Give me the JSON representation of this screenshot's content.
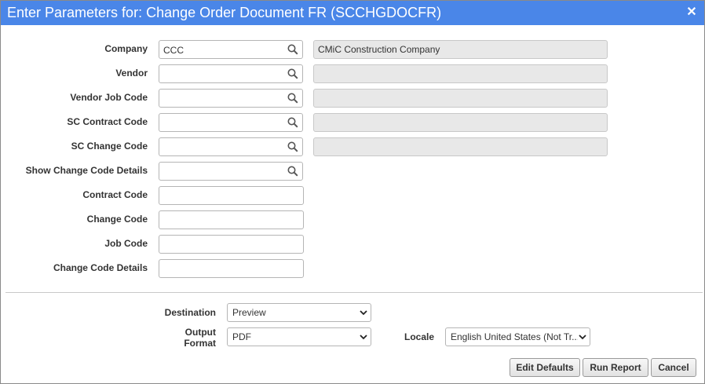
{
  "window": {
    "title": "Enter Parameters for: Change Order Document FR (SCCHGDOCFR)",
    "close_icon": "close-icon"
  },
  "parameters": [
    {
      "label": "Company",
      "value": "CCC",
      "lov": true,
      "description": "CMiC Construction Company"
    },
    {
      "label": "Vendor",
      "value": "",
      "lov": true,
      "description": ""
    },
    {
      "label": "Vendor Job Code",
      "value": "",
      "lov": true,
      "description": ""
    },
    {
      "label": "SC Contract Code",
      "value": "",
      "lov": true,
      "description": ""
    },
    {
      "label": "SC Change Code",
      "value": "",
      "lov": true,
      "description": ""
    },
    {
      "label": "Show Change Code Details",
      "value": "",
      "lov": true
    },
    {
      "label": "Contract Code",
      "value": ""
    },
    {
      "label": "Change Code",
      "value": ""
    },
    {
      "label": "Job Code",
      "value": ""
    },
    {
      "label": "Change Code Details",
      "value": ""
    }
  ],
  "output": {
    "destination_label": "Destination",
    "destination_value": "Preview",
    "format_label_line1": "Output",
    "format_label_line2": "Format",
    "format_value": "PDF",
    "locale_label": "Locale",
    "locale_value": "English United States (Not Tr..."
  },
  "buttons": {
    "edit_defaults": "Edit Defaults",
    "run_report": "Run Report",
    "cancel": "Cancel"
  },
  "colors": {
    "titlebar": "#4a86e8",
    "readonly_bg": "#e8e8e8"
  }
}
